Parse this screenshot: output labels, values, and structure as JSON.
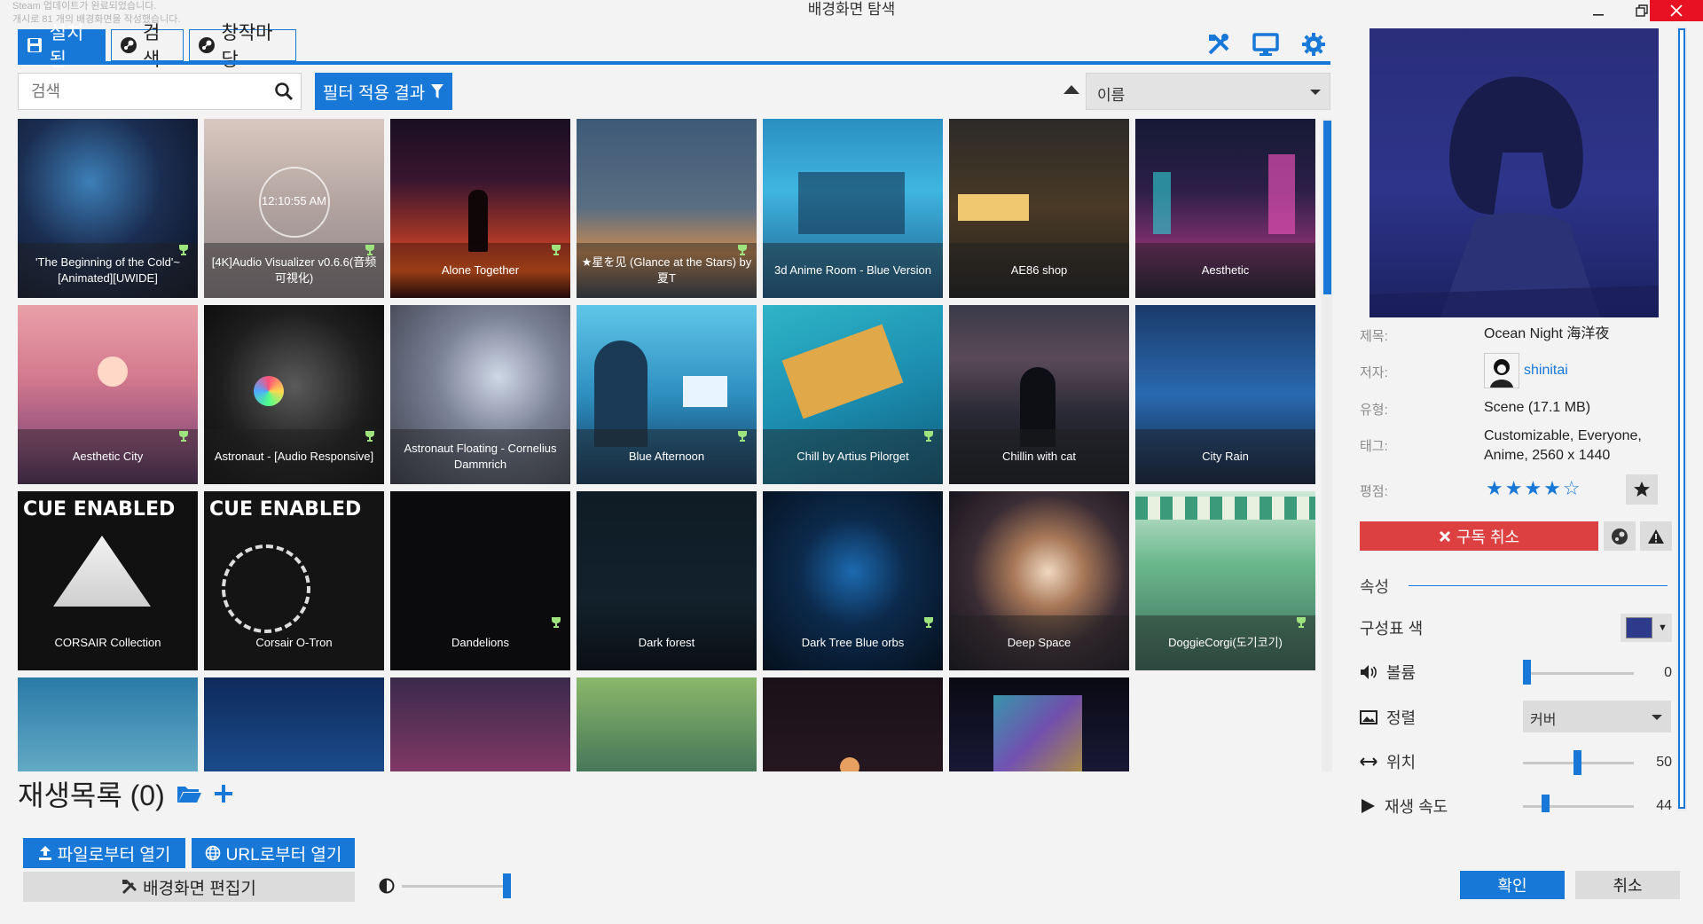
{
  "window": {
    "title": "배경화면 탐색",
    "steam_note_line1": "Steam 업데이트가 완료되었습니다.",
    "steam_note_line2": "개시로 81 개의 배경화면을 작성했습니다."
  },
  "tabs": [
    {
      "label": "설치됨",
      "icon": "save-icon",
      "active": true
    },
    {
      "label": "검색",
      "icon": "steam-icon",
      "active": false
    },
    {
      "label": "창작마당",
      "icon": "steam-icon",
      "active": false
    }
  ],
  "toolbar_icons": [
    "editor-tools-icon",
    "monitor-icon",
    "gear-icon"
  ],
  "search": {
    "placeholder": "검색",
    "value": ""
  },
  "filter_button": "필터 적용 결과",
  "sort": {
    "selected": "이름"
  },
  "wallpapers": [
    {
      "title": "'The Beginning of the Cold'~ [Animated][UWIDE]",
      "trophy": true
    },
    {
      "title": "[4K]Audio Visualizer v0.6.6(音频可視化)",
      "trophy": true,
      "overlay_time": "12:10:55 AM"
    },
    {
      "title": "Alone Together",
      "trophy": true
    },
    {
      "title": "★星を见 (Glance at the Stars) by 夏T",
      "trophy": true
    },
    {
      "title": "3d Anime Room - Blue Version",
      "trophy": false
    },
    {
      "title": "AE86 shop",
      "trophy": false
    },
    {
      "title": "Aesthetic",
      "trophy": false
    },
    {
      "title": "Aesthetic City",
      "trophy": true
    },
    {
      "title": "Astronaut - [Audio Responsive]",
      "trophy": true
    },
    {
      "title": "Astronaut Floating - Cornelius Dammrich",
      "trophy": false
    },
    {
      "title": "Blue Afternoon",
      "trophy": true
    },
    {
      "title": "Chill by Artius Pilorget",
      "trophy": true
    },
    {
      "title": "Chillin with cat",
      "trophy": false
    },
    {
      "title": "City Rain",
      "trophy": false
    },
    {
      "title": "CORSAIR Collection",
      "trophy": false,
      "overlay_text": "CUE ENABLED"
    },
    {
      "title": "Corsair O-Tron",
      "trophy": false,
      "overlay_text": "CUE ENABLED"
    },
    {
      "title": "Dandelions",
      "trophy": true
    },
    {
      "title": "Dark forest",
      "trophy": false
    },
    {
      "title": "Dark Tree Blue orbs",
      "trophy": true
    },
    {
      "title": "Deep Space",
      "trophy": false
    },
    {
      "title": "DoggieCorgi(도기코기)",
      "trophy": true
    },
    {
      "title": "",
      "trophy": false
    },
    {
      "title": "",
      "trophy": false
    },
    {
      "title": "",
      "trophy": false
    },
    {
      "title": "",
      "trophy": false
    },
    {
      "title": "",
      "trophy": false
    },
    {
      "title": "",
      "trophy": false
    }
  ],
  "playlist": {
    "label": "재생목록 (0)"
  },
  "buttons": {
    "open_file": "파일로부터 열기",
    "open_url": "URL로부터 열기",
    "editor": "배경화면 편집기",
    "ok": "확인",
    "cancel": "취소"
  },
  "details": {
    "title_label": "제목:",
    "title_value": "Ocean Night 海洋夜",
    "author_label": "저자:",
    "author_value": "shinitai",
    "type_label": "유형:",
    "type_value": "Scene (17.1 MB)",
    "tags_label": "태그:",
    "tags_value": "Customizable, Everyone, Anime, 2560 x 1440",
    "rating_label": "평점:",
    "rating_stars": "★★★★☆",
    "rating_value": 4,
    "unsubscribe": "구독 취소"
  },
  "properties": {
    "section_title": "속성",
    "scheme_color_label": "구성표 색",
    "scheme_color": "#2e3a8c",
    "volume_label": "볼륨",
    "volume_value": "0",
    "align_label": "정렬",
    "align_value": "커버",
    "position_label": "위치",
    "position_value": "50",
    "speed_label": "재생 속도",
    "speed_value": "44"
  },
  "colors": {
    "accent": "#1878d8",
    "danger": "#dc4041"
  }
}
